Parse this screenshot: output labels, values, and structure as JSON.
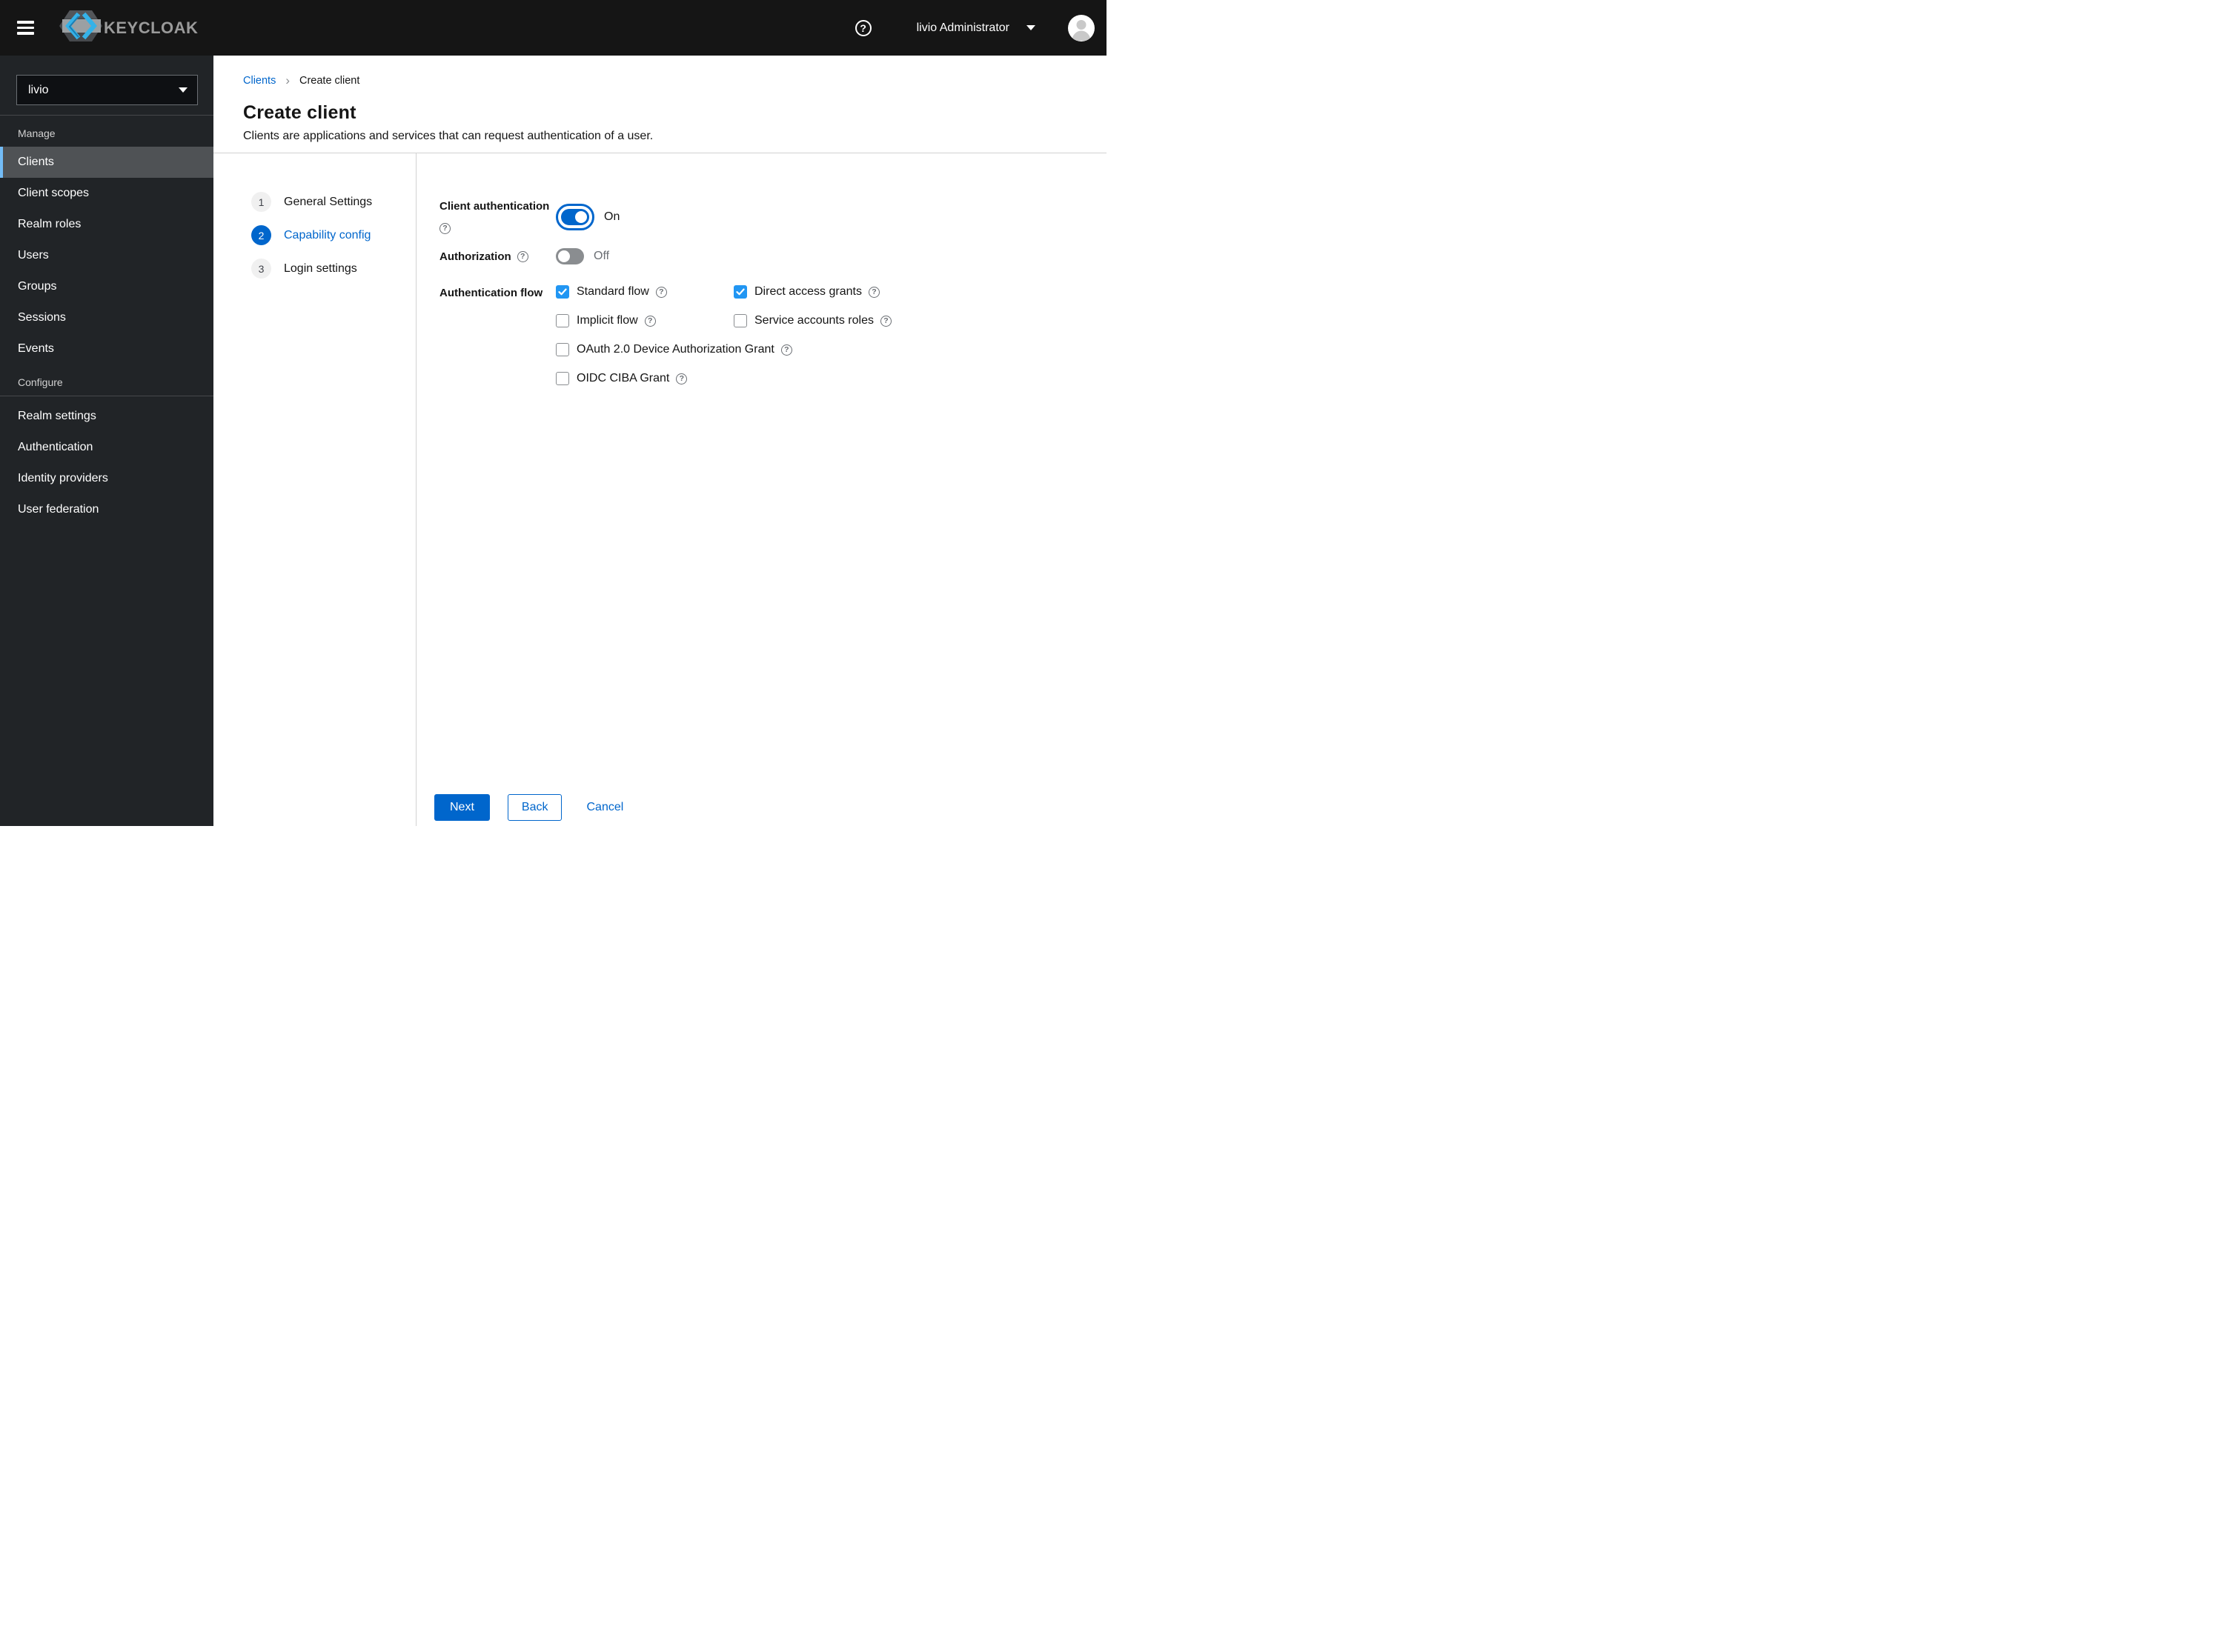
{
  "colors": {
    "accent": "#0066cc",
    "checkbox_checked": "#2196f3",
    "selected_nav_indicator": "#73bcf7",
    "topbar_bg": "#151515",
    "sidebar_bg": "#212427"
  },
  "topbar": {
    "brand": "KEYCLOAK",
    "user_menu": "livio Administrator"
  },
  "sidebar": {
    "realm_selector": {
      "value": "livio"
    },
    "sections": [
      {
        "title": "Manage",
        "items": [
          {
            "label": "Clients",
            "selected": true
          },
          {
            "label": "Client scopes",
            "selected": false
          },
          {
            "label": "Realm roles",
            "selected": false
          },
          {
            "label": "Users",
            "selected": false
          },
          {
            "label": "Groups",
            "selected": false
          },
          {
            "label": "Sessions",
            "selected": false
          },
          {
            "label": "Events",
            "selected": false
          }
        ]
      },
      {
        "title": "Configure",
        "items": [
          {
            "label": "Realm settings",
            "selected": false
          },
          {
            "label": "Authentication",
            "selected": false
          },
          {
            "label": "Identity providers",
            "selected": false
          },
          {
            "label": "User federation",
            "selected": false
          }
        ]
      }
    ]
  },
  "breadcrumb": {
    "link": "Clients",
    "current": "Create client"
  },
  "page": {
    "title": "Create client",
    "subtitle": "Clients are applications and services that can request authentication of a user."
  },
  "wizard": {
    "steps": [
      {
        "number": "1",
        "label": "General Settings",
        "active": false
      },
      {
        "number": "2",
        "label": "Capability config",
        "active": true
      },
      {
        "number": "3",
        "label": "Login settings",
        "active": false
      }
    ]
  },
  "form": {
    "client_authentication": {
      "label": "Client authentication",
      "value": "On",
      "enabled": true
    },
    "authorization": {
      "label": "Authorization",
      "value": "Off",
      "enabled": false
    },
    "authentication_flow": {
      "label": "Authentication flow",
      "options": [
        {
          "label": "Standard flow",
          "checked": true
        },
        {
          "label": "Direct access grants",
          "checked": true
        },
        {
          "label": "Implicit flow",
          "checked": false
        },
        {
          "label": "Service accounts roles",
          "checked": false
        },
        {
          "label": "OAuth 2.0 Device Authorization Grant",
          "checked": false
        },
        {
          "label": "OIDC CIBA Grant",
          "checked": false
        }
      ]
    }
  },
  "footer": {
    "next_label": "Next",
    "back_label": "Back",
    "cancel_label": "Cancel"
  }
}
